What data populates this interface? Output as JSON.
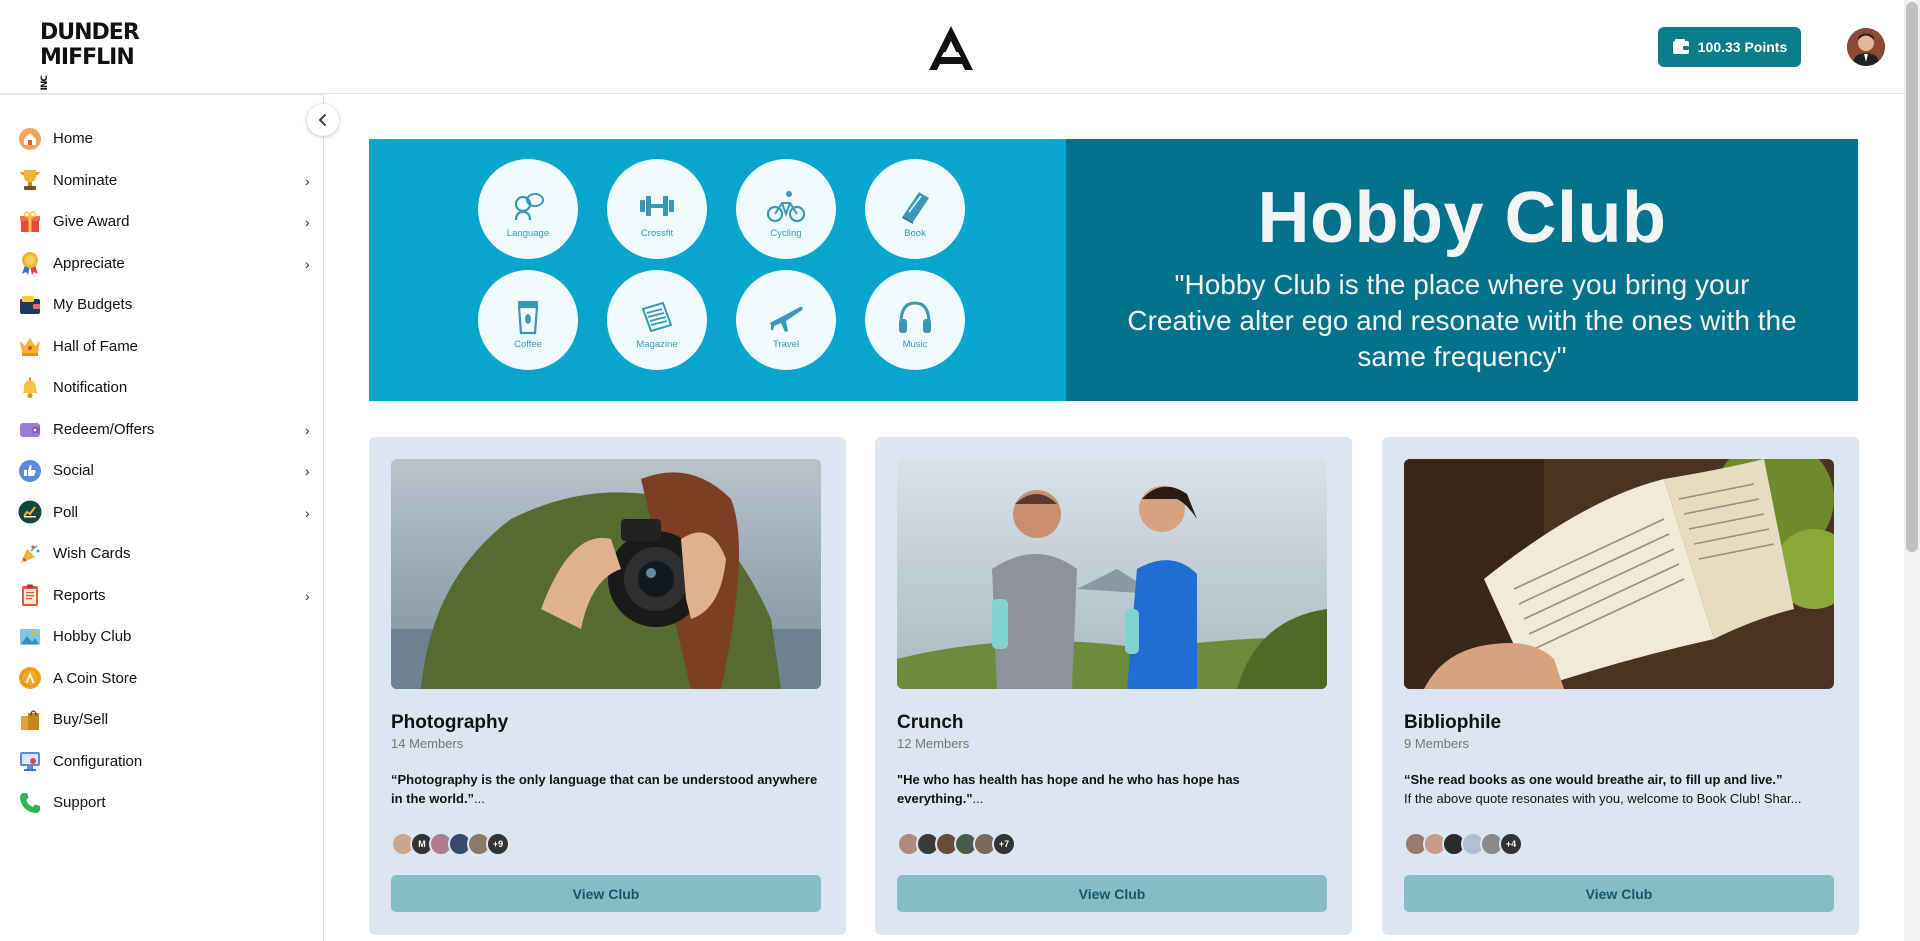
{
  "header": {
    "logo_line1": "DUNDER",
    "logo_line2": "MIFFLIN",
    "logo_suffix": "INC",
    "points_label": "100.33  Points"
  },
  "sidebar": {
    "items": [
      {
        "label": "Home",
        "icon": "house-icon",
        "has_submenu": false
      },
      {
        "label": "Nominate",
        "icon": "trophy-icon",
        "has_submenu": true
      },
      {
        "label": "Give Award",
        "icon": "gift-icon",
        "has_submenu": true
      },
      {
        "label": "Appreciate",
        "icon": "medal-icon",
        "has_submenu": true
      },
      {
        "label": "My Budgets",
        "icon": "wallet-icon",
        "has_submenu": false
      },
      {
        "label": "Hall of Fame",
        "icon": "crown-icon",
        "has_submenu": false
      },
      {
        "label": "Notification",
        "icon": "bell-icon",
        "has_submenu": false
      },
      {
        "label": "Redeem/Offers",
        "icon": "purse-icon",
        "has_submenu": true
      },
      {
        "label": "Social",
        "icon": "thumbs-up-icon",
        "has_submenu": true
      },
      {
        "label": "Poll",
        "icon": "poll-icon",
        "has_submenu": true
      },
      {
        "label": "Wish Cards",
        "icon": "party-popper-icon",
        "has_submenu": false
      },
      {
        "label": "Reports",
        "icon": "clipboard-icon",
        "has_submenu": true
      },
      {
        "label": "Hobby Club",
        "icon": "hobby-icon",
        "has_submenu": false
      },
      {
        "label": "A Coin Store",
        "icon": "coin-icon",
        "has_submenu": false
      },
      {
        "label": "Buy/Sell",
        "icon": "shopping-bags-icon",
        "has_submenu": false
      },
      {
        "label": "Configuration",
        "icon": "configuration-icon",
        "has_submenu": false
      },
      {
        "label": "Support",
        "icon": "phone-icon",
        "has_submenu": false
      }
    ]
  },
  "banner": {
    "title": "Hobby Club",
    "quote": "\"Hobby Club is the place where you bring your Creative alter ego and resonate with the ones with the same frequency\"",
    "hobbies": [
      "Language",
      "Crossfit",
      "Cycling",
      "Book",
      "Coffee",
      "Magazine",
      "Travel",
      "Music"
    ]
  },
  "clubs": [
    {
      "title": "Photography",
      "members": "14 Members",
      "quote_bold": "“Photography is the only language that can be understood anywhere in the world.”",
      "quote_rest": "...",
      "more_count": "+9",
      "button": "View Club"
    },
    {
      "title": "Crunch",
      "members": "12 Members",
      "quote_bold": "\"He who has health has hope and he who has hope has everything.\"",
      "quote_rest": "...",
      "more_count": "+7",
      "button": "View Club"
    },
    {
      "title": "Bibliophile",
      "members": "9 Members",
      "quote_bold": "“She read books as one would breathe air, to fill up and live.”",
      "quote_rest": "If the above quote resonates with you, welcome to Book Club! Shar...",
      "more_count": "+4",
      "button": "View Club"
    }
  ],
  "colors": {
    "accent": "#0d7c8a",
    "banner_light": "#08a6cc",
    "banner_dark": "#03728d",
    "card_bg": "#dce6f0",
    "button_bg": "#86bcc4"
  }
}
